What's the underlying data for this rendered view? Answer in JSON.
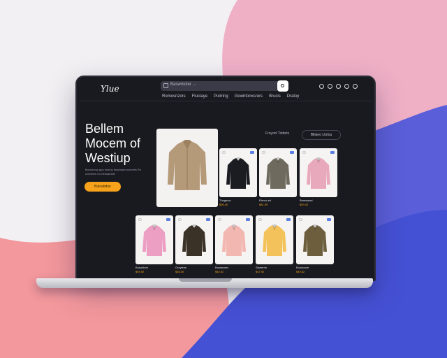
{
  "colors": {
    "accent": "#f6a21a",
    "screen_bg": "#191a20",
    "badge": "#5b7fe2"
  },
  "header": {
    "logo": "Ylue",
    "search_placeholder": "Baswmoter ...",
    "icons": [
      "search-icon",
      "user-icon",
      "wishlist-icon",
      "cart-icon",
      "menu-icon"
    ]
  },
  "nav": [
    "Romosnzors",
    "Fluclaye",
    "Pulrring",
    "Gowirtonxsrors",
    "Brucis",
    "Dratoy"
  ],
  "hero": {
    "title_line1": "Bellem",
    "title_line2": "Mocem of",
    "title_line3": "Westiup",
    "subtitle": "Bosomcup gpo tuseoy fosulogeo scevees Ro uonnelzs Cu beosanelle",
    "cta_label": "Buloatidne"
  },
  "filters": {
    "label": "Froyonl Totdets",
    "pill_label": "Bltiaeo Ltotou"
  },
  "products": [
    {
      "name": "Thogmcu",
      "price": "$95.40",
      "color": "#1b1c22"
    },
    {
      "name": "Fleroo.ed",
      "price": "$81.95",
      "color": "#6e6a5e"
    },
    {
      "name": "Bemeaurd",
      "price": "$93.42",
      "color": "#e9a9bd"
    },
    {
      "name": "Bosunbve",
      "price": "$94.92",
      "color": "#ec9fc3"
    },
    {
      "name": "Groylens",
      "price": "$35.40",
      "color": "#3b3227"
    },
    {
      "name": "Bosranoex",
      "price": "$44.92",
      "color": "#f3b7b1"
    },
    {
      "name": "Slaeerrin",
      "price": "$47.92",
      "color": "#f4c25a"
    },
    {
      "name": "Boursoom",
      "price": "$49.82",
      "color": "#6d5f3d"
    }
  ]
}
